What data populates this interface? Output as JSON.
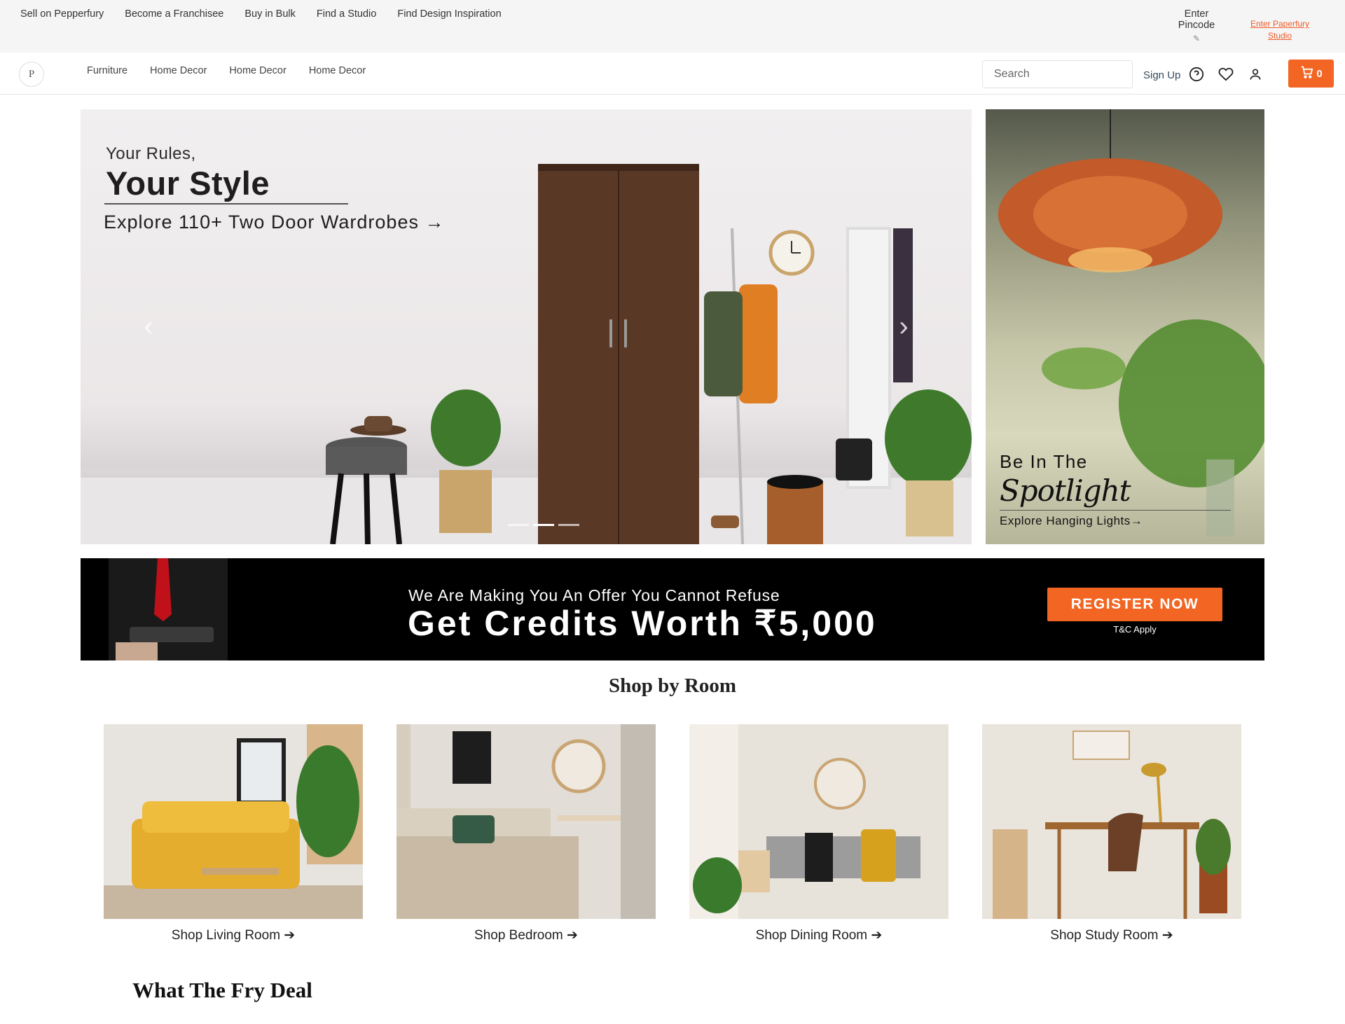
{
  "topbar": {
    "links": [
      "Sell on Pepperfury",
      "Become a Franchisee",
      "Buy in Bulk",
      "Find a Studio",
      "Find Design Inspiration"
    ],
    "pincode_label": "Enter Pincode",
    "studio_link": "Enter Paperfury Studio"
  },
  "nav": {
    "logo_text": "P",
    "links": [
      "Furniture",
      "Home Decor",
      "Home Decor",
      "Home Decor"
    ],
    "search_placeholder": "Search",
    "signup": "Sign Up",
    "cart_count": "0",
    "icons": [
      "help-icon",
      "heart-icon",
      "user-icon",
      "cart-icon"
    ]
  },
  "hero": {
    "main": {
      "line1": "Your Rules,",
      "line2": "Your Style",
      "line3": "Explore 110+ Two Door Wardrobes →"
    },
    "side": {
      "line1": "Be In The",
      "line2": "Spotlight",
      "line3": "Explore Hanging Lights→"
    }
  },
  "offer": {
    "line1": "We Are Making You An Offer You Cannot Refuse",
    "line2": "Get Credits Worth ₹5,000",
    "button": "REGISTER NOW",
    "tnc": "T&C Apply"
  },
  "shop_by_room": {
    "title": "Shop by Room",
    "rooms": [
      {
        "label": "Shop Living Room ➔"
      },
      {
        "label": "Shop Bedroom ➔"
      },
      {
        "label": "Shop Dining Room ➔"
      },
      {
        "label": "Shop Study Room ➔"
      }
    ]
  },
  "deal": {
    "title": "What The Fry Deal"
  },
  "colors": {
    "accent": "#f26522",
    "topbar_bg": "#f5f5f5",
    "offer_bg": "#000000"
  }
}
